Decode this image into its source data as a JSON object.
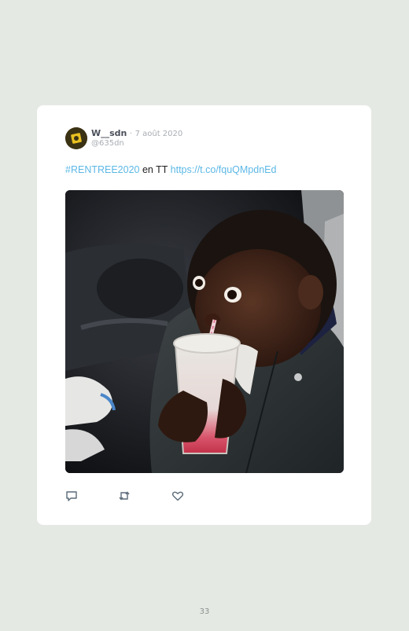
{
  "tweet": {
    "display_name": "W__sdn",
    "separator": "·",
    "date": "7 août 2020",
    "handle": "@635dn",
    "hashtag": "#RENTREE2020",
    "body_text": " en TT ",
    "link": "https://t.co/fquQMpdnEd",
    "avatar_icon": "yellow-square-logo-icon",
    "media_description_icon": "photo"
  },
  "actions": {
    "reply_icon": "reply-icon",
    "retweet_icon": "retweet-icon",
    "like_icon": "heart-icon"
  },
  "page": {
    "number": "33"
  },
  "colors": {
    "background": "#e5e9e3",
    "card": "#ffffff",
    "link": "#5cb8e6",
    "muted": "#a8adb3"
  }
}
